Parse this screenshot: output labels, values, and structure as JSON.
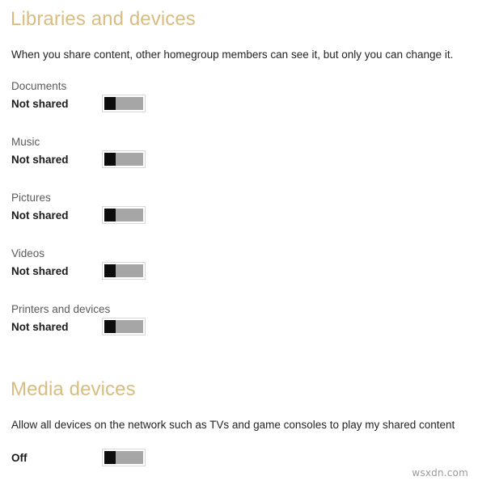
{
  "sections": {
    "libraries": {
      "heading": "Libraries and devices",
      "description": "When you share content, other homegroup members can see it, but only you can change it.",
      "heading_color": "#d9bd80",
      "rows": [
        {
          "title": "Documents",
          "state": "Not shared",
          "toggle": "off"
        },
        {
          "title": "Music",
          "state": "Not shared",
          "toggle": "off"
        },
        {
          "title": "Pictures",
          "state": "Not shared",
          "toggle": "off"
        },
        {
          "title": "Videos",
          "state": "Not shared",
          "toggle": "off"
        },
        {
          "title": "Printers and devices",
          "state": "Not shared",
          "toggle": "off"
        }
      ]
    },
    "media": {
      "heading": "Media devices",
      "description": "Allow all devices on the network such as TVs and game consoles to play my shared content",
      "heading_color": "#d9bd80",
      "row": {
        "state": "Off",
        "toggle": "off"
      }
    }
  },
  "watermark": "wsxdn.com"
}
